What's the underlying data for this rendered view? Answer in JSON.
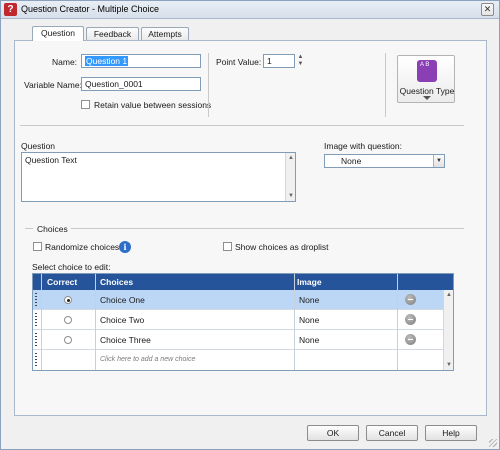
{
  "window": {
    "title": "Question Creator - Multiple Choice",
    "app_icon": "?",
    "close_icon": "close-icon"
  },
  "tabs": [
    {
      "label": "Question",
      "active": true
    },
    {
      "label": "Feedback",
      "active": false
    },
    {
      "label": "Attempts",
      "active": false
    }
  ],
  "form": {
    "name_label": "Name:",
    "name_value": "Question 1",
    "variable_label": "Variable Name:",
    "variable_value": "Question_0001",
    "retain_label": "Retain value between sessions",
    "point_label": "Point Value:",
    "point_value": "1",
    "question_type_label": "Question Type",
    "question_type_icon_text": "A B"
  },
  "question": {
    "label": "Question",
    "text": "Question Text",
    "image_label": "Image with question:",
    "image_value": "None"
  },
  "choices": {
    "section_label": "Choices",
    "randomize_label": "Randomize choices",
    "droplist_label": "Show choices as droplist",
    "select_label": "Select choice to edit:",
    "headers": {
      "correct": "Correct",
      "choices": "Choices",
      "image": "Image"
    },
    "rows": [
      {
        "choice": "Choice One",
        "image": "None",
        "correct": true,
        "selected": true
      },
      {
        "choice": "Choice Two",
        "image": "None",
        "correct": false,
        "selected": false
      },
      {
        "choice": "Choice Three",
        "image": "None",
        "correct": false,
        "selected": false
      }
    ],
    "add_placeholder": "Click here to add a new choice"
  },
  "buttons": {
    "ok": "OK",
    "cancel": "Cancel",
    "help": "Help"
  }
}
